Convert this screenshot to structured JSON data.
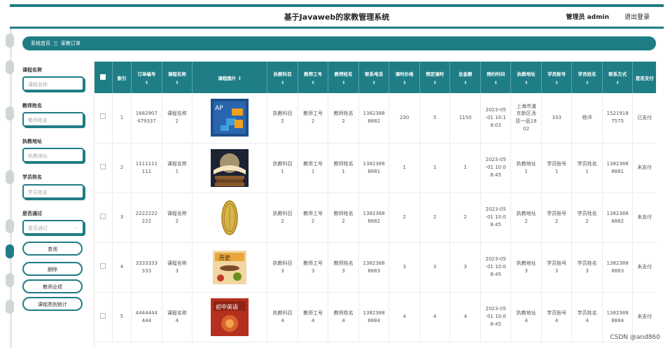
{
  "header": {
    "title": "基于Javaweb的家教管理系统",
    "user": "管理员 admin",
    "logout": "退出登录"
  },
  "breadcrumb": {
    "home": "系统首页",
    "separator": "三",
    "current": "家教订单"
  },
  "filters": {
    "course_name": {
      "label": "课程名称",
      "placeholder": "课程名称"
    },
    "teacher_name": {
      "label": "教师姓名",
      "placeholder": "教师姓名"
    },
    "teach_address": {
      "label": "执教地址",
      "placeholder": "执教地址"
    },
    "student_name": {
      "label": "学员姓名",
      "placeholder": "学员姓名"
    },
    "approved": {
      "label": "是否通过",
      "placeholder": "是否通过"
    }
  },
  "buttons": {
    "search": "查询",
    "delete": "删除",
    "teacher_performance": "教师业绩",
    "course_stats": "课程类别统计"
  },
  "table": {
    "columns": [
      "索引",
      "订单编号",
      "课程名称",
      "课程图片",
      "执教科目",
      "教师工号",
      "教师姓名",
      "联系电话",
      "课时价格",
      "预定课时",
      "总金额",
      "预约时间",
      "执教地址",
      "学员账号",
      "学员姓名",
      "联系方式",
      "是否支付"
    ],
    "rows": [
      {
        "index": "1",
        "order_no": "1682907\n479337",
        "course": "课程名称\n2",
        "subject": "执教科目\n2",
        "teacher_id": "教师工号\n2",
        "teacher_name": "教师姓名\n2",
        "phone": "1382388\n8882",
        "price": "230",
        "hours": "5",
        "total": "1150",
        "time": "2023-05\n-01 10:1\n8:02",
        "address": "上海市浦\n东新区汤\n臣一品18\n02",
        "student_acct": "333",
        "student_name": "杨洋",
        "contact": "1521918\n7575",
        "paid": "已支付"
      },
      {
        "index": "2",
        "order_no": "1111111\n111",
        "course": "课程名称\n1",
        "subject": "执教科目\n1",
        "teacher_id": "教师工号\n1",
        "teacher_name": "教师姓名\n1",
        "phone": "1382388\n8881",
        "price": "1",
        "hours": "1",
        "total": "1",
        "time": "2023-05\n-01 10:0\n8:45",
        "address": "执教地址\n1",
        "student_acct": "学员账号\n1",
        "student_name": "学员姓名\n1",
        "contact": "1382388\n8881",
        "paid": "未支付"
      },
      {
        "index": "3",
        "order_no": "2222222\n222",
        "course": "课程名称\n2",
        "subject": "执教科目\n2",
        "teacher_id": "教师工号\n2",
        "teacher_name": "教师姓名\n2",
        "phone": "1382388\n8882",
        "price": "2",
        "hours": "2",
        "total": "2",
        "time": "2023-05\n-01 10:0\n8:45",
        "address": "执教地址\n2",
        "student_acct": "学员账号\n2",
        "student_name": "学员姓名\n2",
        "contact": "1382388\n8882",
        "paid": "未支付"
      },
      {
        "index": "4",
        "order_no": "3333333\n333",
        "course": "课程名称\n3",
        "subject": "执教科目\n3",
        "teacher_id": "教师工号\n3",
        "teacher_name": "教师姓名\n3",
        "phone": "1382388\n8883",
        "price": "3",
        "hours": "3",
        "total": "3",
        "time": "2023-05\n-01 10:0\n8:45",
        "address": "执教地址\n3",
        "student_acct": "学员账号\n3",
        "student_name": "学员姓名\n3",
        "contact": "1382388\n8883",
        "paid": "未支付"
      },
      {
        "index": "5",
        "order_no": "4444444\n444",
        "course": "课程名称\n4",
        "subject": "执教科目\n4",
        "teacher_id": "教师工号\n4",
        "teacher_name": "教师姓名\n4",
        "phone": "1382388\n8884",
        "price": "4",
        "hours": "4",
        "total": "4",
        "time": "2023-05\n-01 10:0\n8:45",
        "address": "执教地址\n4",
        "student_acct": "学员账号\n4",
        "student_name": "学员姓名\n4",
        "contact": "1382388\n8884",
        "paid": "未支付"
      }
    ]
  },
  "thumbs": [
    "ap-book-cover",
    "open-book-photo",
    "gold-coin",
    "history-book-cover",
    "english-book-cover"
  ],
  "watermark": "CSDN @and860",
  "colors": {
    "accent": "#1f7d86"
  }
}
